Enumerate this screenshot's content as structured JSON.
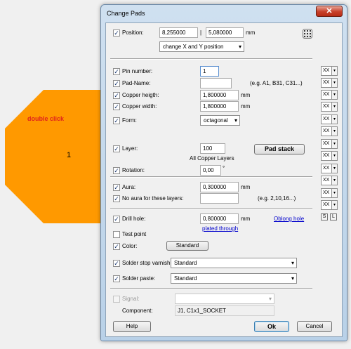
{
  "window": {
    "title": "Change Pads",
    "close_glyph": "✕"
  },
  "canvas": {
    "hint": "double click",
    "pad_number": "1",
    "pad_color": "#ff9900"
  },
  "position": {
    "label": "Position:",
    "x": "8,255000",
    "sep": "|",
    "y": "5,080000",
    "unit": "mm",
    "mode": "change X and Y position",
    "grid_icon": "grid-icon"
  },
  "pin_number": {
    "label": "Pin number:",
    "value": "1"
  },
  "pad_name": {
    "label": "Pad-Name:",
    "value": "",
    "hint": "(e.g. A1, B31, C31...)"
  },
  "copper_height": {
    "label": "Copper heigth:",
    "value": "1,800000",
    "unit": "mm"
  },
  "copper_width": {
    "label": "Copper width:",
    "value": "1,800000",
    "unit": "mm"
  },
  "form": {
    "label": "Form:",
    "value": "octagonal"
  },
  "layer": {
    "label": "Layer:",
    "value": "100",
    "description": "All Copper Layers",
    "pad_stack": "Pad stack"
  },
  "rotation": {
    "label": "Rotation:",
    "value": "0,00",
    "unit": "°"
  },
  "aura": {
    "label": "Aura:",
    "value": "0,300000",
    "unit": "mm"
  },
  "no_aura": {
    "label": "No aura for these layers:",
    "value": "",
    "hint": "(e.g. 2,10,16...)"
  },
  "drill": {
    "label": "Drill hole:",
    "value": "0,800000",
    "unit": "mm",
    "oblong": "Oblong hole",
    "plated": "plated through"
  },
  "test_point": {
    "label": "Test point"
  },
  "color": {
    "label": "Color:",
    "value": "Standard"
  },
  "solder_stop": {
    "label": "Solder stop varnish:",
    "value": "Standard"
  },
  "solder_paste": {
    "label": "Solder paste:",
    "value": "Standard"
  },
  "signal": {
    "label": "Signal:",
    "value": ""
  },
  "component": {
    "label": "Component:",
    "value": "J1, C1x1_SOCKET"
  },
  "buttons": {
    "help": "Help",
    "ok": "Ok",
    "cancel": "Cancel"
  },
  "side": {
    "xx": "XX",
    "s": "S",
    "l": "L"
  },
  "check_glyph": "✓"
}
